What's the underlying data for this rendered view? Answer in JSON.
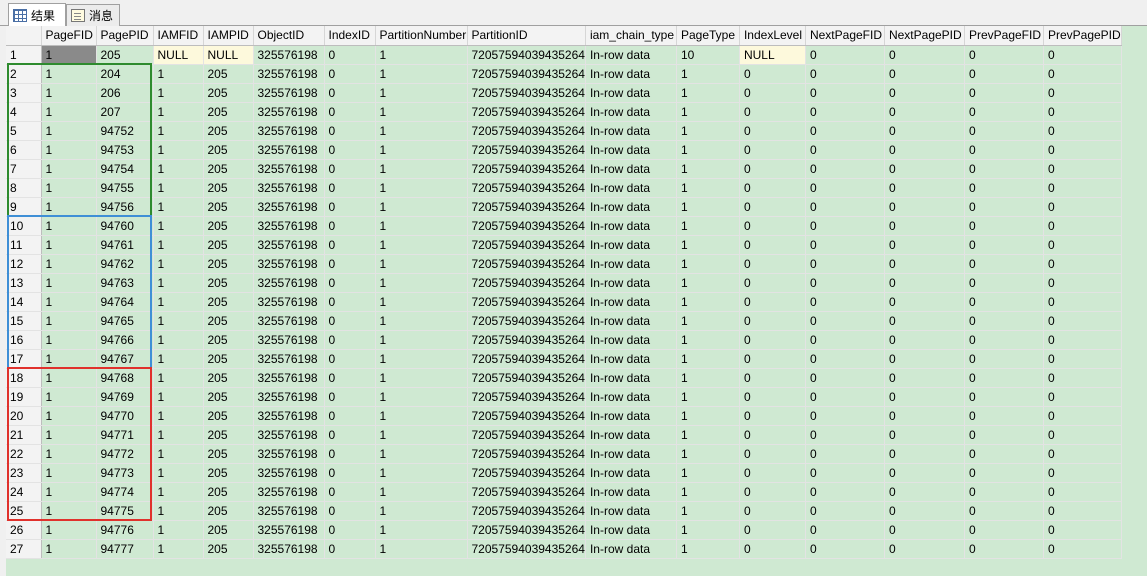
{
  "tabs": [
    {
      "label": "结果",
      "icon": "results-grid-icon",
      "active": true
    },
    {
      "label": "消息",
      "icon": "messages-icon",
      "active": false
    }
  ],
  "columns": [
    "PageFID",
    "PagePID",
    "IAMFID",
    "IAMPID",
    "ObjectID",
    "IndexID",
    "PartitionNumber",
    "PartitionID",
    "iam_chain_type",
    "PageType",
    "IndexLevel",
    "NextPageFID",
    "NextPagePID",
    "PrevPageFID",
    "PrevPagePID"
  ],
  "rows": [
    [
      "1",
      "1",
      "205",
      "NULL",
      "NULL",
      "325576198",
      "0",
      "1",
      "72057594039435264",
      "In-row data",
      "10",
      "NULL",
      "0",
      "0",
      "0",
      "0"
    ],
    [
      "2",
      "1",
      "204",
      "1",
      "205",
      "325576198",
      "0",
      "1",
      "72057594039435264",
      "In-row data",
      "1",
      "0",
      "0",
      "0",
      "0",
      "0"
    ],
    [
      "3",
      "1",
      "206",
      "1",
      "205",
      "325576198",
      "0",
      "1",
      "72057594039435264",
      "In-row data",
      "1",
      "0",
      "0",
      "0",
      "0",
      "0"
    ],
    [
      "4",
      "1",
      "207",
      "1",
      "205",
      "325576198",
      "0",
      "1",
      "72057594039435264",
      "In-row data",
      "1",
      "0",
      "0",
      "0",
      "0",
      "0"
    ],
    [
      "5",
      "1",
      "94752",
      "1",
      "205",
      "325576198",
      "0",
      "1",
      "72057594039435264",
      "In-row data",
      "1",
      "0",
      "0",
      "0",
      "0",
      "0"
    ],
    [
      "6",
      "1",
      "94753",
      "1",
      "205",
      "325576198",
      "0",
      "1",
      "72057594039435264",
      "In-row data",
      "1",
      "0",
      "0",
      "0",
      "0",
      "0"
    ],
    [
      "7",
      "1",
      "94754",
      "1",
      "205",
      "325576198",
      "0",
      "1",
      "72057594039435264",
      "In-row data",
      "1",
      "0",
      "0",
      "0",
      "0",
      "0"
    ],
    [
      "8",
      "1",
      "94755",
      "1",
      "205",
      "325576198",
      "0",
      "1",
      "72057594039435264",
      "In-row data",
      "1",
      "0",
      "0",
      "0",
      "0",
      "0"
    ],
    [
      "9",
      "1",
      "94756",
      "1",
      "205",
      "325576198",
      "0",
      "1",
      "72057594039435264",
      "In-row data",
      "1",
      "0",
      "0",
      "0",
      "0",
      "0"
    ],
    [
      "10",
      "1",
      "94760",
      "1",
      "205",
      "325576198",
      "0",
      "1",
      "72057594039435264",
      "In-row data",
      "1",
      "0",
      "0",
      "0",
      "0",
      "0"
    ],
    [
      "11",
      "1",
      "94761",
      "1",
      "205",
      "325576198",
      "0",
      "1",
      "72057594039435264",
      "In-row data",
      "1",
      "0",
      "0",
      "0",
      "0",
      "0"
    ],
    [
      "12",
      "1",
      "94762",
      "1",
      "205",
      "325576198",
      "0",
      "1",
      "72057594039435264",
      "In-row data",
      "1",
      "0",
      "0",
      "0",
      "0",
      "0"
    ],
    [
      "13",
      "1",
      "94763",
      "1",
      "205",
      "325576198",
      "0",
      "1",
      "72057594039435264",
      "In-row data",
      "1",
      "0",
      "0",
      "0",
      "0",
      "0"
    ],
    [
      "14",
      "1",
      "94764",
      "1",
      "205",
      "325576198",
      "0",
      "1",
      "72057594039435264",
      "In-row data",
      "1",
      "0",
      "0",
      "0",
      "0",
      "0"
    ],
    [
      "15",
      "1",
      "94765",
      "1",
      "205",
      "325576198",
      "0",
      "1",
      "72057594039435264",
      "In-row data",
      "1",
      "0",
      "0",
      "0",
      "0",
      "0"
    ],
    [
      "16",
      "1",
      "94766",
      "1",
      "205",
      "325576198",
      "0",
      "1",
      "72057594039435264",
      "In-row data",
      "1",
      "0",
      "0",
      "0",
      "0",
      "0"
    ],
    [
      "17",
      "1",
      "94767",
      "1",
      "205",
      "325576198",
      "0",
      "1",
      "72057594039435264",
      "In-row data",
      "1",
      "0",
      "0",
      "0",
      "0",
      "0"
    ],
    [
      "18",
      "1",
      "94768",
      "1",
      "205",
      "325576198",
      "0",
      "1",
      "72057594039435264",
      "In-row data",
      "1",
      "0",
      "0",
      "0",
      "0",
      "0"
    ],
    [
      "19",
      "1",
      "94769",
      "1",
      "205",
      "325576198",
      "0",
      "1",
      "72057594039435264",
      "In-row data",
      "1",
      "0",
      "0",
      "0",
      "0",
      "0"
    ],
    [
      "20",
      "1",
      "94770",
      "1",
      "205",
      "325576198",
      "0",
      "1",
      "72057594039435264",
      "In-row data",
      "1",
      "0",
      "0",
      "0",
      "0",
      "0"
    ],
    [
      "21",
      "1",
      "94771",
      "1",
      "205",
      "325576198",
      "0",
      "1",
      "72057594039435264",
      "In-row data",
      "1",
      "0",
      "0",
      "0",
      "0",
      "0"
    ],
    [
      "22",
      "1",
      "94772",
      "1",
      "205",
      "325576198",
      "0",
      "1",
      "72057594039435264",
      "In-row data",
      "1",
      "0",
      "0",
      "0",
      "0",
      "0"
    ],
    [
      "23",
      "1",
      "94773",
      "1",
      "205",
      "325576198",
      "0",
      "1",
      "72057594039435264",
      "In-row data",
      "1",
      "0",
      "0",
      "0",
      "0",
      "0"
    ],
    [
      "24",
      "1",
      "94774",
      "1",
      "205",
      "325576198",
      "0",
      "1",
      "72057594039435264",
      "In-row data",
      "1",
      "0",
      "0",
      "0",
      "0",
      "0"
    ],
    [
      "25",
      "1",
      "94775",
      "1",
      "205",
      "325576198",
      "0",
      "1",
      "72057594039435264",
      "In-row data",
      "1",
      "0",
      "0",
      "0",
      "0",
      "0"
    ],
    [
      "26",
      "1",
      "94776",
      "1",
      "205",
      "325576198",
      "0",
      "1",
      "72057594039435264",
      "In-row data",
      "1",
      "0",
      "0",
      "0",
      "0",
      "0"
    ],
    [
      "27",
      "1",
      "94777",
      "1",
      "205",
      "325576198",
      "0",
      "1",
      "72057594039435264",
      "In-row data",
      "1",
      "0",
      "0",
      "0",
      "0",
      "0"
    ]
  ],
  "highlight_groups": [
    {
      "name": "green-group",
      "color": "#2e8b2e",
      "first_row": 2,
      "last_row": 9
    },
    {
      "name": "blue-group",
      "color": "#3f8fd6",
      "first_row": 10,
      "last_row": 17
    },
    {
      "name": "red-group",
      "color": "#e0312c",
      "first_row": 18,
      "last_row": 25
    }
  ]
}
